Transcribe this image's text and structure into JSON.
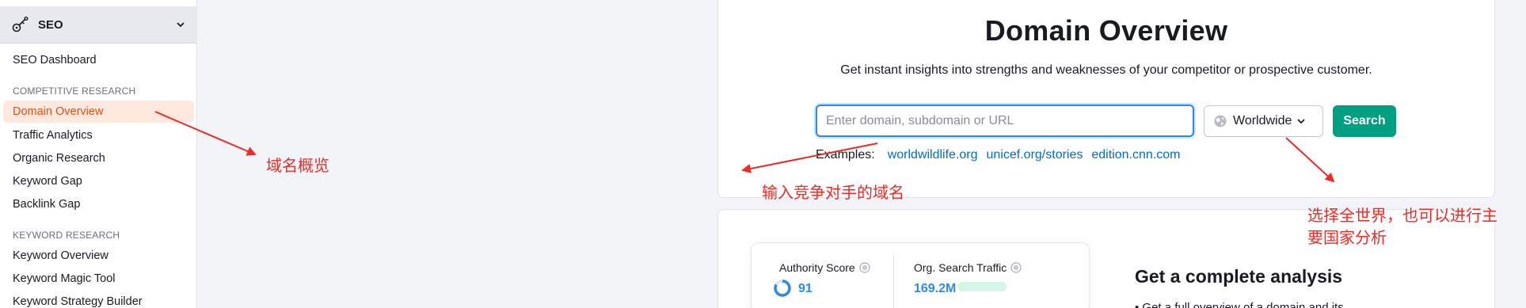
{
  "sidebar": {
    "tool_title": "SEO",
    "dashboard_label": "SEO Dashboard",
    "section_competitive": "COMPETITIVE RESEARCH",
    "competitive_items": [
      "Domain Overview",
      "Traffic Analytics",
      "Organic Research",
      "Keyword Gap",
      "Backlink Gap"
    ],
    "section_keyword": "KEYWORD RESEARCH",
    "keyword_items": [
      "Keyword Overview",
      "Keyword Magic Tool",
      "Keyword Strategy Builder"
    ]
  },
  "main": {
    "title": "Domain Overview",
    "subtitle": "Get instant insights into strengths and weaknesses of your competitor or prospective customer.",
    "search_placeholder": "Enter domain, subdomain or URL",
    "region_value": "Worldwide",
    "search_button": "Search",
    "examples_label": "Examples:",
    "examples": [
      "worldwildlife.org",
      "unicef.org/stories",
      "edition.cnn.com"
    ]
  },
  "preview": {
    "authority_label": "Authority Score",
    "authority_value": "91",
    "traffic_label": "Org. Search Traffic",
    "traffic_value": "169.2M",
    "analysis_title": "Get a complete analysis",
    "analysis_bullet": "• Get a full overview of a domain and its"
  },
  "annotations": {
    "domain_overview_note": "域名概览",
    "input_note": "输入竞争对手的域名",
    "region_note_line1": "选择全世界，也可以进行主",
    "region_note_line2": "要国家分析"
  },
  "colors": {
    "accent_orange": "#e04f12",
    "search_green": "#009f81",
    "link_blue": "#006dca",
    "annotation_red": "#ee2a24"
  }
}
